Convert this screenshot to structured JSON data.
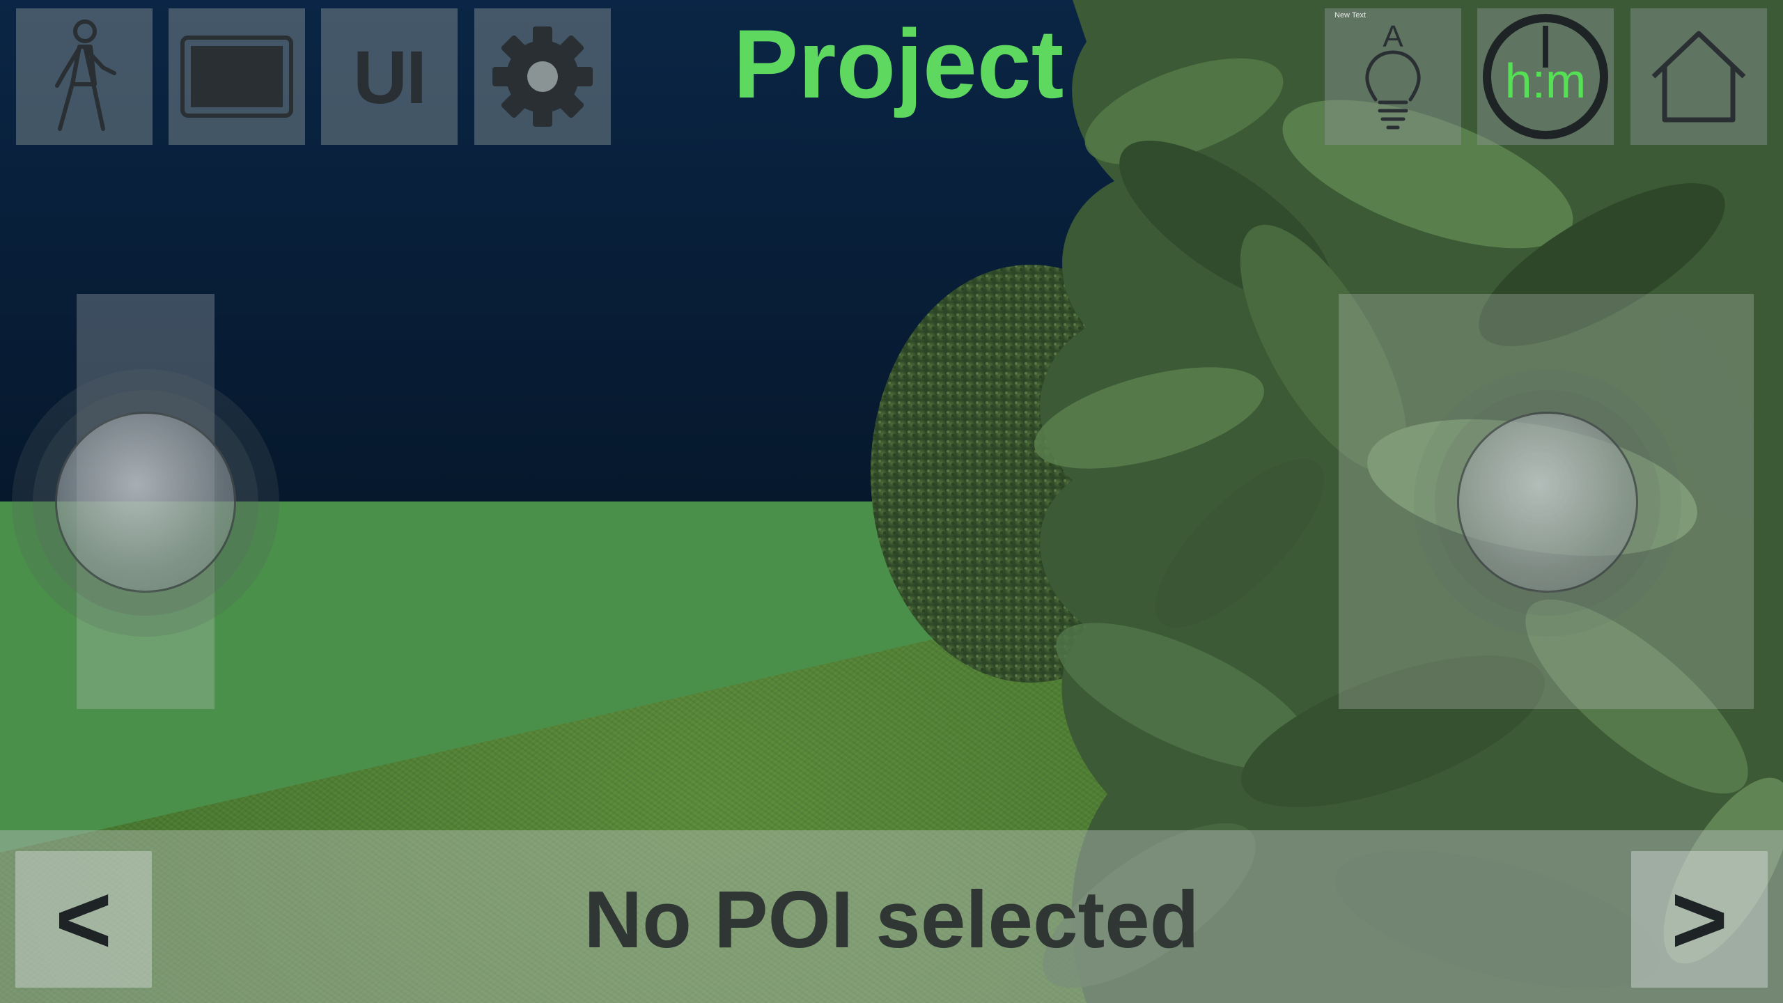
{
  "header": {
    "title": "Project",
    "title_color": "#5fd860"
  },
  "toolbar_left": [
    {
      "icon": "walk-icon"
    },
    {
      "icon": "screen-icon"
    },
    {
      "icon": "ui-toggle",
      "label": "UI"
    },
    {
      "icon": "gear-icon"
    }
  ],
  "toolbar_right": {
    "light": {
      "icon": "lightbulb-icon",
      "letter": "A",
      "caption": "New Text"
    },
    "clock": {
      "icon": "clock-icon",
      "label": "h:m"
    },
    "home": {
      "icon": "home-icon"
    }
  },
  "joysticks": {
    "left": "move-joystick",
    "right": "look-joystick"
  },
  "poi_bar": {
    "prev_label": "<",
    "next_label": ">",
    "status": "No POI selected"
  },
  "colors": {
    "accent_green": "#5fd860",
    "sky": "#0a2545",
    "lawn": "#4a8f4a"
  }
}
